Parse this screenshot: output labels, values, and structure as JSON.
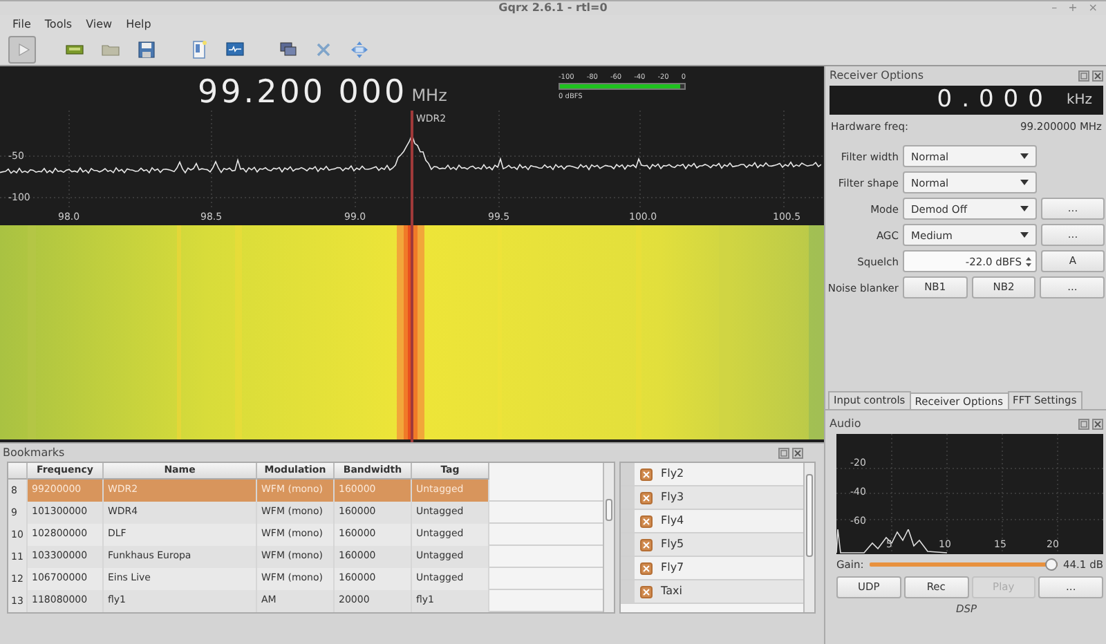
{
  "window": {
    "title": "Gqrx 2.6.1 - rtl=0",
    "controls": [
      "–",
      "+",
      "×"
    ]
  },
  "menu": [
    "File",
    "Tools",
    "View",
    "Help"
  ],
  "frequency": {
    "value": "99.200 000",
    "unit": "MHz"
  },
  "meter": {
    "ticks": [
      "-100",
      "-80",
      "-60",
      "-40",
      "-20",
      "0"
    ],
    "level": 0.97,
    "reading": "0 dBFS"
  },
  "spectrum": {
    "y_labels": [
      "-50",
      "-100"
    ],
    "x_labels": [
      "98.0",
      "98.5",
      "99.0",
      "99.5",
      "100.0",
      "100.5"
    ],
    "marker": "WDR2"
  },
  "receiver": {
    "title": "Receiver Options",
    "offset": {
      "value": "0.000",
      "unit": "kHz"
    },
    "hardware_label": "Hardware freq:",
    "hardware_value": "99.200000 MHz",
    "rows": [
      {
        "label": "Filter width",
        "kind": "select",
        "value": "Normal"
      },
      {
        "label": "Filter shape",
        "kind": "select",
        "value": "Normal"
      },
      {
        "label": "Mode",
        "kind": "select",
        "value": "Demod Off",
        "button": "..."
      },
      {
        "label": "AGC",
        "kind": "select",
        "value": "Medium",
        "button": "..."
      },
      {
        "label": "Squelch",
        "kind": "spin",
        "value": "-22.0 dBFS",
        "button": "A"
      },
      {
        "label": "Noise blanker",
        "kind": "buttons",
        "buttons": [
          "NB1",
          "NB2",
          "..."
        ]
      }
    ]
  },
  "tabs": [
    {
      "label": "Input controls",
      "selected": false
    },
    {
      "label": "Receiver Options",
      "selected": true
    },
    {
      "label": "FFT Settings",
      "selected": false
    }
  ],
  "audio": {
    "title": "Audio",
    "y_labels": [
      "-20",
      "-40",
      "-60"
    ],
    "x_labels": [
      "5",
      "10",
      "15",
      "20"
    ],
    "gain_label": "Gain:",
    "gain": {
      "level": 0.96
    },
    "gain_reading": "44.1 dB",
    "buttons": [
      {
        "label": "UDP",
        "disabled": false
      },
      {
        "label": "Rec",
        "disabled": false
      },
      {
        "label": "Play",
        "disabled": true
      },
      {
        "label": "...",
        "disabled": false
      }
    ],
    "footer": "DSP"
  },
  "bookmarks": {
    "title": "Bookmarks",
    "columns": [
      "Frequency",
      "Name",
      "Modulation",
      "Bandwidth",
      "Tag"
    ],
    "rows": [
      {
        "index": "8",
        "cells": [
          "99200000",
          "WDR2",
          "WFM (mono)",
          "160000",
          "Untagged"
        ],
        "selected": true
      },
      {
        "index": "9",
        "cells": [
          "101300000",
          "WDR4",
          "WFM (mono)",
          "160000",
          "Untagged"
        ],
        "selected": false
      },
      {
        "index": "10",
        "cells": [
          "102800000",
          "DLF",
          "WFM (mono)",
          "160000",
          "Untagged"
        ],
        "selected": false
      },
      {
        "index": "11",
        "cells": [
          "103300000",
          "Funkhaus Europa",
          "WFM (mono)",
          "160000",
          "Untagged"
        ],
        "selected": false
      },
      {
        "index": "12",
        "cells": [
          "106700000",
          "Eins Live",
          "WFM (mono)",
          "160000",
          "Untagged"
        ],
        "selected": false
      },
      {
        "index": "13",
        "cells": [
          "118080000",
          "fly1",
          "AM",
          "20000",
          "fly1"
        ],
        "selected": false
      }
    ],
    "tags": [
      {
        "label": "Fly2",
        "checked": true
      },
      {
        "label": "Fly3",
        "checked": true
      },
      {
        "label": "Fly4",
        "checked": true
      },
      {
        "label": "Fly5",
        "checked": true
      },
      {
        "label": "Fly7",
        "checked": true
      },
      {
        "label": "Taxi",
        "checked": true
      }
    ]
  }
}
